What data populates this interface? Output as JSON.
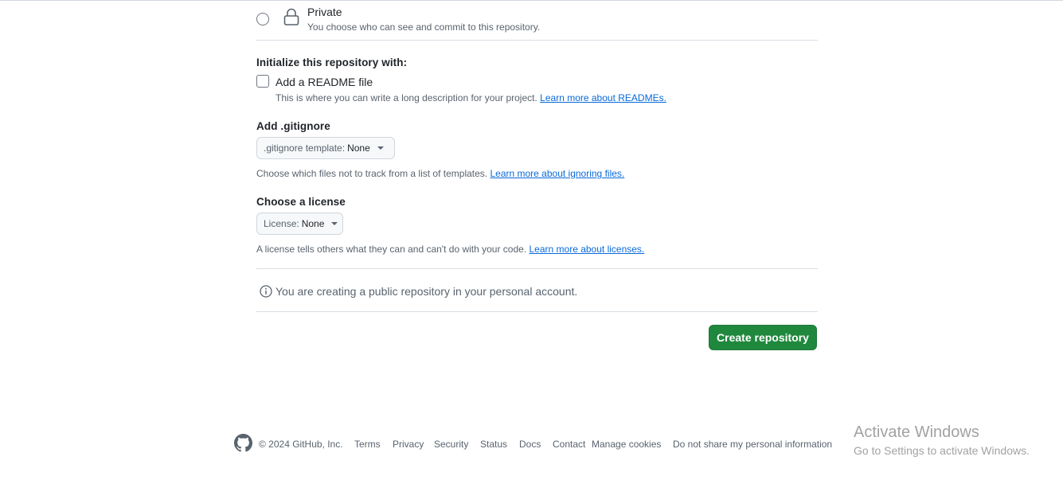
{
  "visibility": {
    "private_label": "Private",
    "private_desc": "You choose who can see and commit to this repository."
  },
  "initialize": {
    "heading": "Initialize this repository with:",
    "readme_label": "Add a README file",
    "readme_desc": "This is where you can write a long description for your project.",
    "readme_link": "Learn more about READMEs."
  },
  "gitignore": {
    "heading": "Add .gitignore",
    "select_prefix": ".gitignore template:",
    "select_value": "None",
    "desc": "Choose which files not to track from a list of templates.",
    "link": "Learn more about ignoring files."
  },
  "license": {
    "heading": "Choose a license",
    "select_prefix": "License:",
    "select_value": "None",
    "desc": "A license tells others what they can and can't do with your code.",
    "link": "Learn more about licenses."
  },
  "notice": {
    "text": "You are creating a public repository in your personal account."
  },
  "actions": {
    "create_label": "Create repository"
  },
  "footer": {
    "copyright": "© 2024 GitHub, Inc.",
    "links": [
      "Terms",
      "Privacy",
      "Security",
      "Status",
      "Docs",
      "Contact",
      "Manage cookies",
      "Do not share my personal information"
    ]
  },
  "watermark": {
    "title": "Activate Windows",
    "subtitle": "Go to Settings to activate Windows."
  },
  "colors": {
    "primary_button": "#1f883d",
    "link": "#0969da",
    "muted_text": "#59636e"
  },
  "icons": [
    "lock-icon",
    "info-icon",
    "github-logo-icon",
    "caret-down-icon"
  ]
}
